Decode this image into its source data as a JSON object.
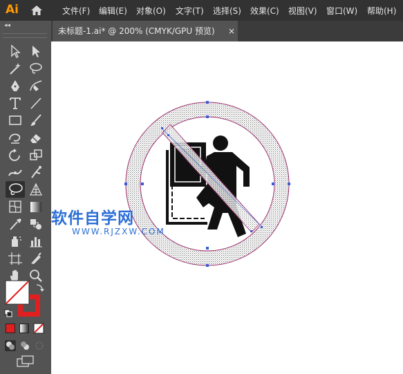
{
  "app": {
    "logo": "Ai"
  },
  "menu": [
    {
      "label": "文件(F)"
    },
    {
      "label": "编辑(E)"
    },
    {
      "label": "对象(O)"
    },
    {
      "label": "文字(T)"
    },
    {
      "label": "选择(S)"
    },
    {
      "label": "效果(C)"
    },
    {
      "label": "视图(V)"
    },
    {
      "label": "窗口(W)"
    },
    {
      "label": "帮助(H)"
    }
  ],
  "document_tab": {
    "title": "未标题-1.ai* @ 200% (CMYK/GPU 预览)",
    "close_glyph": "×"
  },
  "toolbar": {
    "collapse_glyph": "◂◂",
    "selected_tool": "lasso-tool"
  },
  "colors": {
    "accent": "#ff9a00",
    "stroke": "#e02020",
    "selection": "#3a5bd9",
    "path": "#9b2c6b"
  },
  "watermark": {
    "line1": "软件自学网",
    "line2": "WWW.RJZXW.COM"
  }
}
